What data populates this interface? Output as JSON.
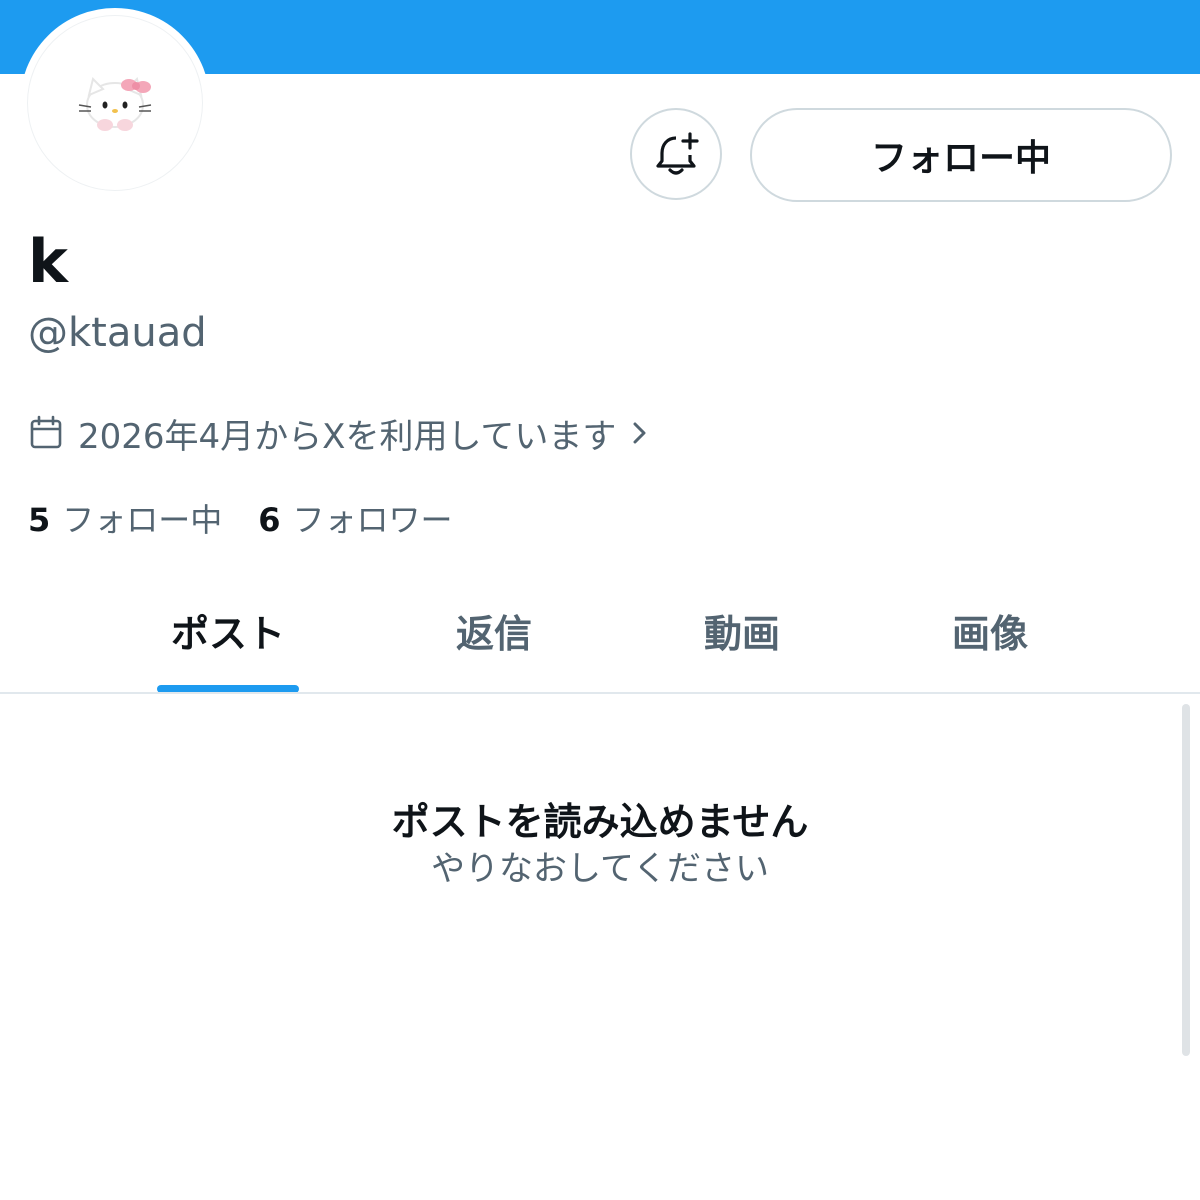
{
  "profile": {
    "display_name": "k",
    "handle": "@ktauad",
    "joined": "2026年4月からXを利用しています",
    "following_count": "5",
    "following_label": "フォロー中",
    "followers_count": "6",
    "followers_label": "フォロワー"
  },
  "actions": {
    "notify_icon": "bell-plus-icon",
    "follow_label": "フォロー中"
  },
  "tabs": [
    {
      "label": "ポスト",
      "active": true
    },
    {
      "label": "返信",
      "active": false
    },
    {
      "label": "動画",
      "active": false
    },
    {
      "label": "画像",
      "active": false
    }
  ],
  "empty_state": {
    "title": "ポストを読み込めません",
    "subtitle": "やりなおしてください"
  },
  "colors": {
    "accent": "#1d9bf0",
    "text_primary": "#0f1419",
    "text_secondary": "#536471",
    "border": "#cfd9de"
  }
}
